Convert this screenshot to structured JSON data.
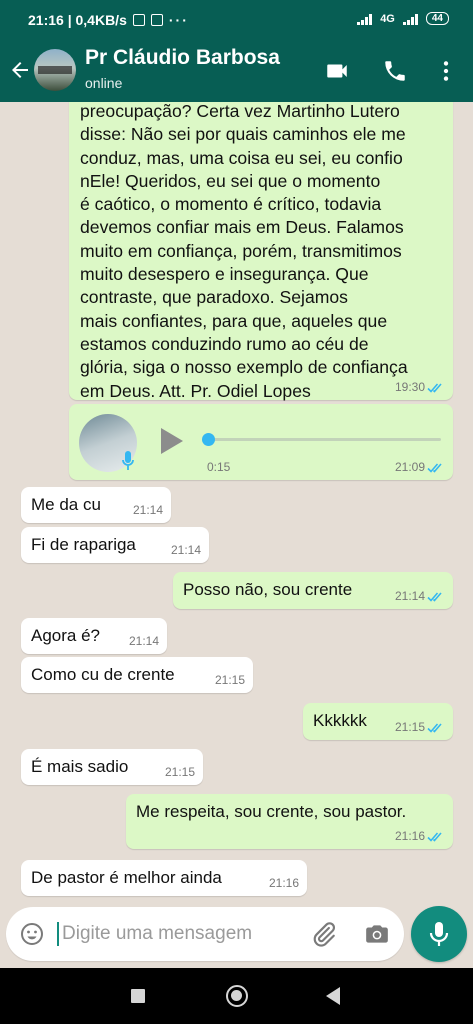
{
  "status_bar": {
    "time_speed": "21:16 | 0,4KB/s",
    "more": "···",
    "network": "4G",
    "battery": "44"
  },
  "header": {
    "contact_name": "Pr Cláudio Barbosa",
    "status": "online"
  },
  "messages": [
    {
      "type": "outgoing",
      "lines": [
        "preocupação? Certa vez Martinho Lutero",
        "disse: Não sei por quais caminhos ele me",
        "conduz, mas, uma coisa eu sei, eu confio",
        "nEle! Queridos, eu sei que o momento",
        "é caótico, o momento é crítico, todavia",
        "devemos confiar mais em Deus. Falamos",
        "muito em confiança, porém, transmitimos",
        "muito desespero e insegurança. Que",
        "contraste, que paradoxo. Sejamos",
        "mais confiantes, para que, aqueles que",
        "estamos conduzindo rumo ao céu de",
        "glória, siga o nosso exemplo de confiança",
        "em Deus. Att. Pr. Odiel Lopes"
      ],
      "time": "19:30"
    },
    {
      "type": "outgoing-voice",
      "duration": "0:15",
      "time": "21:09",
      "progress": 0
    },
    {
      "type": "incoming",
      "text": "Me da cu",
      "time": "21:14"
    },
    {
      "type": "incoming",
      "text": "Fi de rapariga",
      "time": "21:14"
    },
    {
      "type": "outgoing",
      "text": "Posso não, sou crente",
      "time": "21:14"
    },
    {
      "type": "incoming",
      "text": "Agora é?",
      "time": "21:14"
    },
    {
      "type": "incoming",
      "text": "Como cu de crente",
      "time": "21:15"
    },
    {
      "type": "outgoing",
      "text": "Kkkkkk",
      "time": "21:15"
    },
    {
      "type": "incoming",
      "text": "É mais sadio",
      "time": "21:15"
    },
    {
      "type": "outgoing",
      "text": "Me respeita, sou crente, sou pastor.",
      "time": "21:16"
    },
    {
      "type": "incoming",
      "text": "De pastor é melhor ainda",
      "time": "21:16"
    }
  ],
  "input": {
    "placeholder": "Digite uma mensagem"
  },
  "icons": {
    "back": "arrow-left-icon",
    "video": "video-call-icon",
    "call": "phone-icon",
    "menu": "more-vertical-icon",
    "emoji": "emoji-icon",
    "attach": "paperclip-icon",
    "camera": "camera-icon",
    "mic": "microphone-icon",
    "read": "double-check-icon"
  },
  "colors": {
    "header": "#075e54",
    "outgoing_bubble": "#dcf8c6",
    "incoming_bubble": "#ffffff",
    "chat_bg": "#e5ddd5",
    "accent": "#128c7e",
    "read_ticks": "#34b7f1"
  }
}
